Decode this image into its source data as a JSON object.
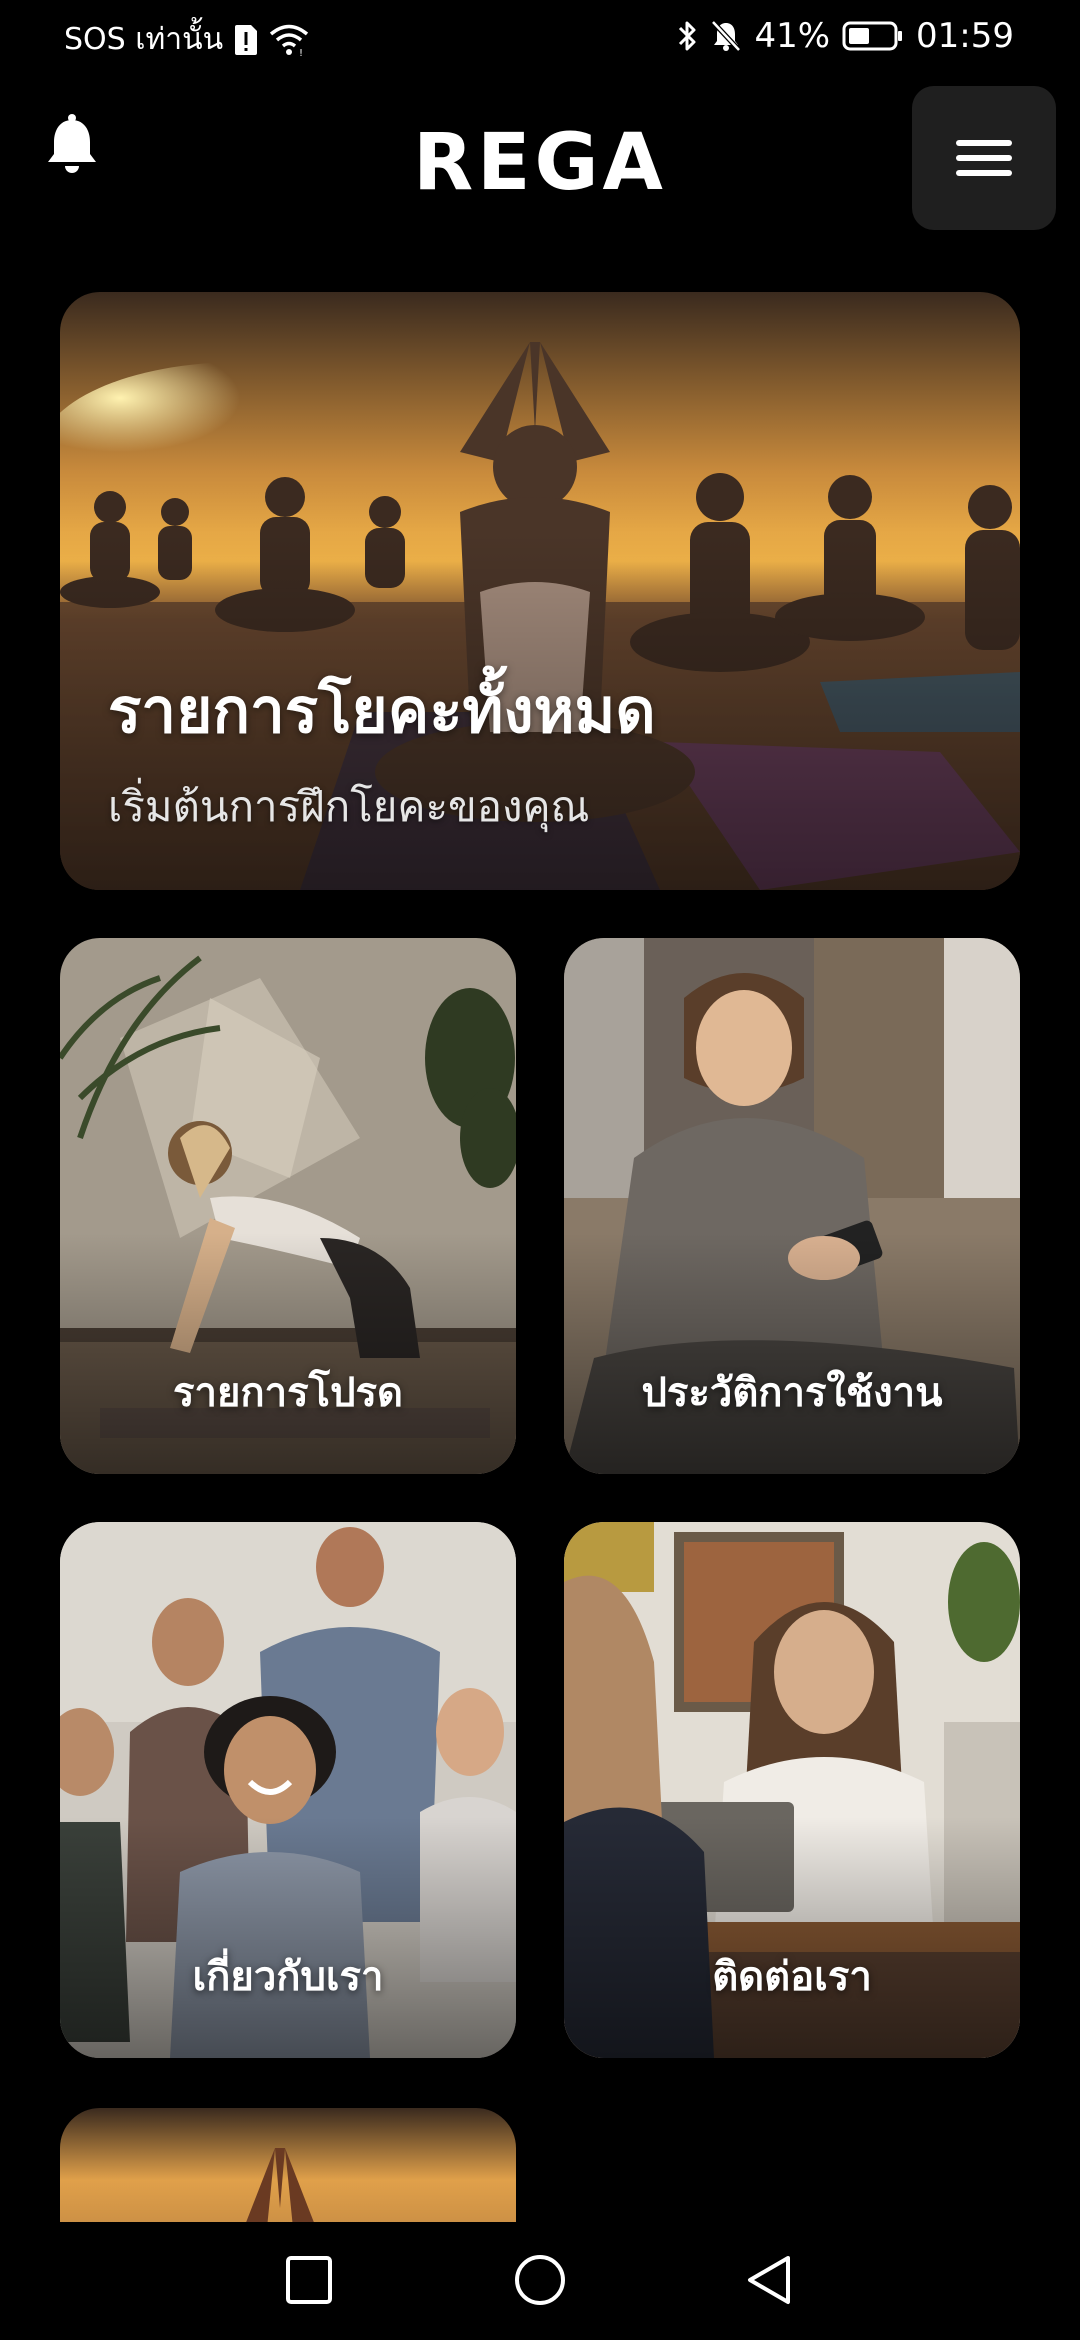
{
  "status_bar": {
    "carrier": "SOS เท่านั้น",
    "battery": "41%",
    "time": "01:59",
    "icons": [
      "sim-alert-icon",
      "wifi-icon",
      "bluetooth-icon",
      "mute-icon",
      "battery-icon"
    ]
  },
  "header": {
    "title": "REGA",
    "bell_icon": "bell-icon",
    "menu_icon": "hamburger-menu-icon"
  },
  "hero": {
    "title": "รายการโยคะทั้งหมด",
    "subtitle": "เริ่มต้นการฝึกโยคะของคุณ"
  },
  "cards": [
    {
      "label": "รายการโปรด"
    },
    {
      "label": "ประวัติการใช้งาน"
    },
    {
      "label": "เกี่ยวกับเรา"
    },
    {
      "label": "ติดต่อเรา"
    }
  ],
  "nav_bar": {
    "icons": [
      "recents-square-icon",
      "home-circle-icon",
      "back-triangle-icon"
    ]
  },
  "colors": {
    "background": "#000000",
    "menu_button": "#1f1f1f",
    "text": "#ffffff"
  }
}
